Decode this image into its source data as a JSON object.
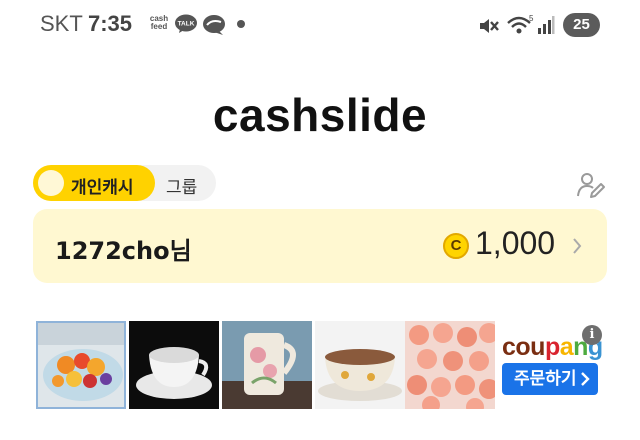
{
  "status_bar": {
    "carrier": "SKT",
    "time": "7:35",
    "cashfeed_line1": "cash",
    "cashfeed_line2": "feed",
    "talk_badge": "TALK",
    "battery": "25",
    "icons": [
      "cashfeed-icon",
      "kakaotalk-icon",
      "chat-bubble-icon",
      "notification-dot",
      "mute-icon",
      "wifi-icon",
      "signal-icon",
      "battery-icon"
    ]
  },
  "app": {
    "logo": "cashslide"
  },
  "tabs": {
    "personal": "개인캐시",
    "group": "그룹"
  },
  "profile_edit_icon": "profile-edit-icon",
  "balance": {
    "username": "1272cho님",
    "coin_symbol": "C",
    "amount": "1,000"
  },
  "ads": {
    "brand_parts": [
      {
        "text": "cou",
        "color": "#7a2e12"
      },
      {
        "text": "p",
        "color": "#d9232e"
      },
      {
        "text": "a",
        "color": "#f7b500"
      },
      {
        "text": "n",
        "color": "#4dab3f"
      },
      {
        "text": "g",
        "color": "#3a93d2"
      }
    ],
    "order_button": "주문하기",
    "info_symbol": "i",
    "tiles": [
      "fruit-bowl-image",
      "teacup-image",
      "mug-image",
      "soup-cup-image",
      "shrimp-image"
    ]
  },
  "colors": {
    "accent_yellow": "#ffd200",
    "card_bg": "#fff8d1",
    "button_blue": "#1a73e8"
  }
}
